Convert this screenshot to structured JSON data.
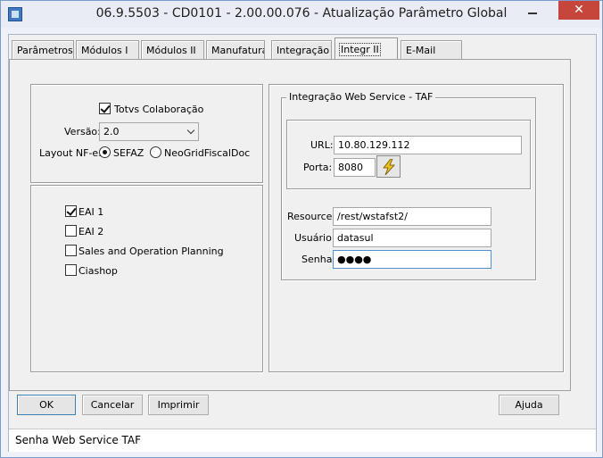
{
  "window": {
    "title": "06.9.5503 - CD0101 - 2.00.00.076 - Atualização Parâmetro Global",
    "close_glyph": "✕"
  },
  "tabs": [
    {
      "label": "Parâmetros",
      "active": false
    },
    {
      "label": "Módulos I",
      "active": false
    },
    {
      "label": "Módulos II",
      "active": false
    },
    {
      "label": "Manufatura",
      "active": false
    },
    {
      "label": "Integração",
      "active": false
    },
    {
      "label": "Integr II",
      "active": true
    },
    {
      "label": "E-Mail",
      "active": false
    }
  ],
  "totvs": {
    "colaboracao_label": "Totvs Colaboração",
    "colaboracao_checked": true,
    "versao_label": "Versão:",
    "versao_value": "2.0",
    "layout_label": "Layout NF-e:",
    "layout_options": [
      "SEFAZ",
      "NeoGridFiscalDoc"
    ],
    "layout_selected": "SEFAZ"
  },
  "eai": {
    "items": [
      {
        "label": "EAI 1",
        "checked": true
      },
      {
        "label": "EAI 2",
        "checked": false
      },
      {
        "label": "Sales and Operation Planning",
        "checked": false
      },
      {
        "label": "Ciashop",
        "checked": false
      }
    ]
  },
  "webservice": {
    "legend": "Integração Web Service - TAF",
    "url_label": "URL:",
    "url_value": "10.80.129.112",
    "porta_label": "Porta:",
    "porta_value": "8080",
    "resource_label": "Resource:",
    "resource_value": "/rest/wstafst2/",
    "usuario_label": "Usuário:",
    "usuario_value": "datasul",
    "senha_label": "Senha:",
    "senha_value": "●●●●"
  },
  "buttons": {
    "ok": "OK",
    "cancelar": "Cancelar",
    "imprimir": "Imprimir",
    "ajuda": "Ajuda"
  },
  "status": {
    "text": "Senha Web Service  TAF"
  },
  "colors": {
    "close_button": "#c7463b",
    "focus_border": "#4f8fd4"
  }
}
